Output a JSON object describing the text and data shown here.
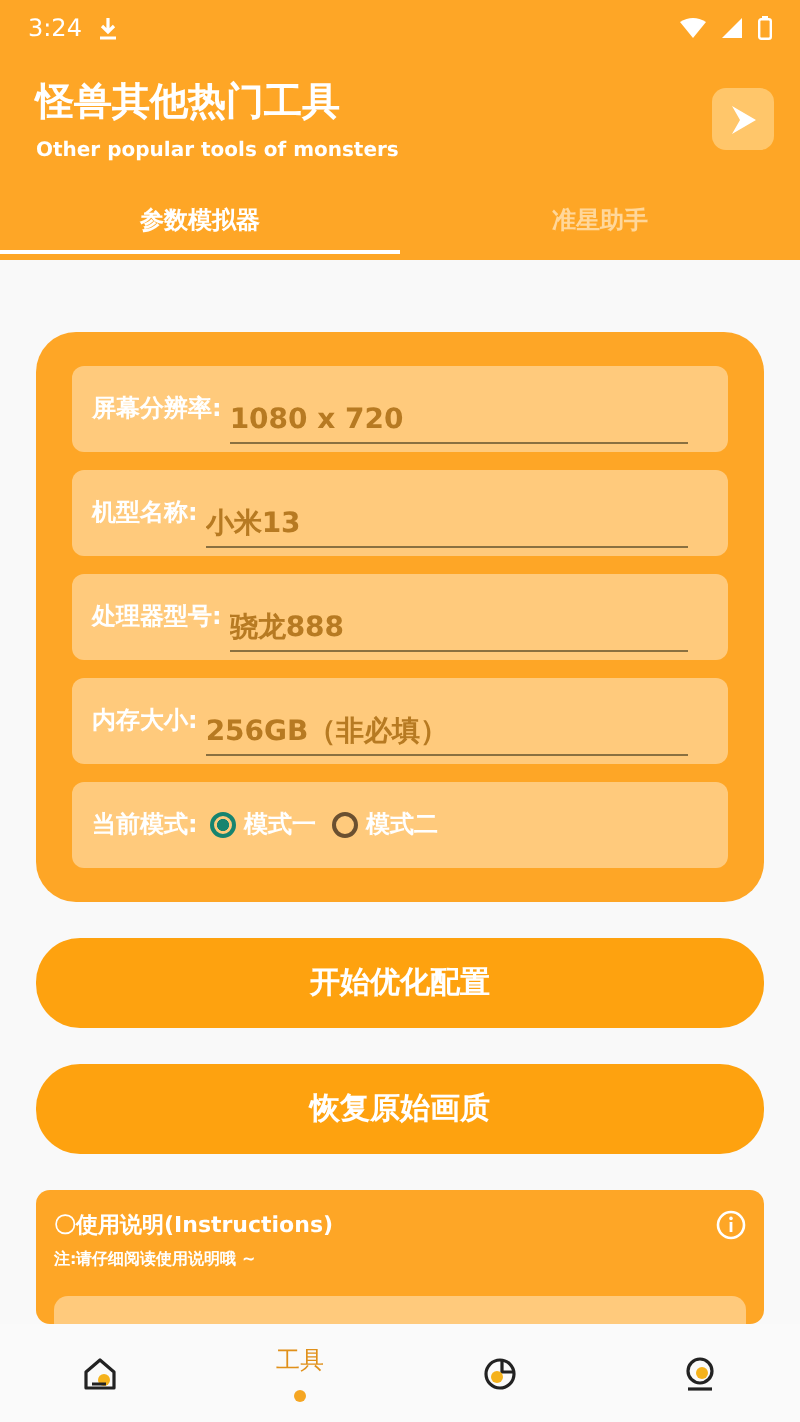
{
  "status_bar": {
    "time": "3:24"
  },
  "header": {
    "title": "怪兽其他热门工具",
    "subtitle": "Other popular tools of monsters"
  },
  "tabs": [
    {
      "label": "参数模拟器",
      "selected": true
    },
    {
      "label": "准星助手",
      "selected": false
    }
  ],
  "form_rows": [
    {
      "kind": "input",
      "label": "屏幕分辨率:",
      "placeholder": "1080 x 720"
    },
    {
      "kind": "input",
      "label": "机型名称:",
      "placeholder": "小米13"
    },
    {
      "kind": "input",
      "label": "处理器型号:",
      "placeholder": "骁龙888"
    },
    {
      "kind": "input",
      "label": "内存大小:",
      "placeholder": "256GB（非必填）"
    },
    {
      "kind": "radio",
      "label": "当前模式:",
      "options": [
        {
          "label": "模式一",
          "selected": true
        },
        {
          "label": "模式二",
          "selected": false
        }
      ]
    }
  ],
  "buttons": [
    "开始优化配置",
    "恢复原始画质"
  ],
  "instructions": {
    "title": "〇使用说明(Instructions)",
    "note": "注:请仔细阅读使用说明哦 ~"
  },
  "bottom_nav": [
    {
      "kind": "home",
      "selected": false
    },
    {
      "kind": "tools",
      "label": "工具",
      "selected": true
    },
    {
      "kind": "chart",
      "selected": false
    },
    {
      "kind": "profile",
      "selected": false
    }
  ]
}
